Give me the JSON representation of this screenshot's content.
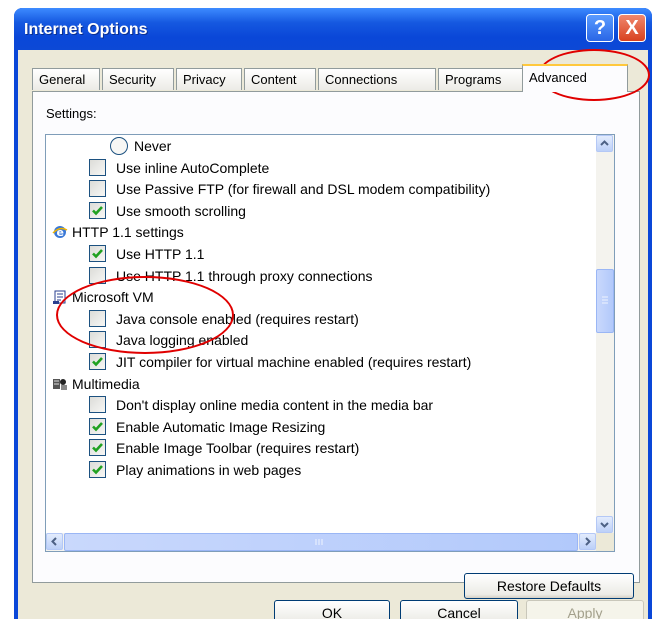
{
  "window": {
    "title": "Internet Options",
    "help_glyph": "?",
    "close_glyph": "X"
  },
  "tabs": [
    {
      "label": "General"
    },
    {
      "label": "Security"
    },
    {
      "label": "Privacy"
    },
    {
      "label": "Content"
    },
    {
      "label": "Connections"
    },
    {
      "label": "Programs"
    },
    {
      "label": "Advanced"
    }
  ],
  "panel": {
    "settings_label": "Settings:"
  },
  "settings": [
    {
      "type": "radio",
      "label": "Never",
      "checked": false
    },
    {
      "type": "checkbox",
      "label": "Use inline AutoComplete",
      "checked": false
    },
    {
      "type": "checkbox",
      "label": "Use Passive FTP (for firewall and DSL modem compatibility)",
      "checked": false
    },
    {
      "type": "checkbox",
      "label": "Use smooth scrolling",
      "checked": true
    },
    {
      "type": "group",
      "label": "HTTP 1.1 settings",
      "icon": "ie-globe-icon"
    },
    {
      "type": "checkbox",
      "label": "Use HTTP 1.1",
      "checked": true
    },
    {
      "type": "checkbox",
      "label": "Use HTTP 1.1 through proxy connections",
      "checked": false
    },
    {
      "type": "group",
      "label": "Microsoft VM",
      "icon": "java-icon"
    },
    {
      "type": "checkbox",
      "label": "Java console enabled (requires restart)",
      "checked": false
    },
    {
      "type": "checkbox",
      "label": "Java logging enabled",
      "checked": false
    },
    {
      "type": "checkbox",
      "label": "JIT compiler for virtual machine enabled (requires restart)",
      "checked": true
    },
    {
      "type": "group",
      "label": "Multimedia",
      "icon": "multimedia-icon"
    },
    {
      "type": "checkbox",
      "label": "Don't display online media content in the media bar",
      "checked": false
    },
    {
      "type": "checkbox",
      "label": "Enable Automatic Image Resizing",
      "checked": true
    },
    {
      "type": "checkbox",
      "label": "Enable Image Toolbar (requires restart)",
      "checked": true
    },
    {
      "type": "checkbox",
      "label": "Play animations in web pages",
      "checked": true
    }
  ],
  "buttons": {
    "restore_defaults": "Restore Defaults",
    "ok": "OK",
    "cancel": "Cancel",
    "apply": "Apply"
  },
  "colors": {
    "titlebar": "#0a47d8",
    "checkmark": "#21a121",
    "annotation": "#e00000"
  }
}
